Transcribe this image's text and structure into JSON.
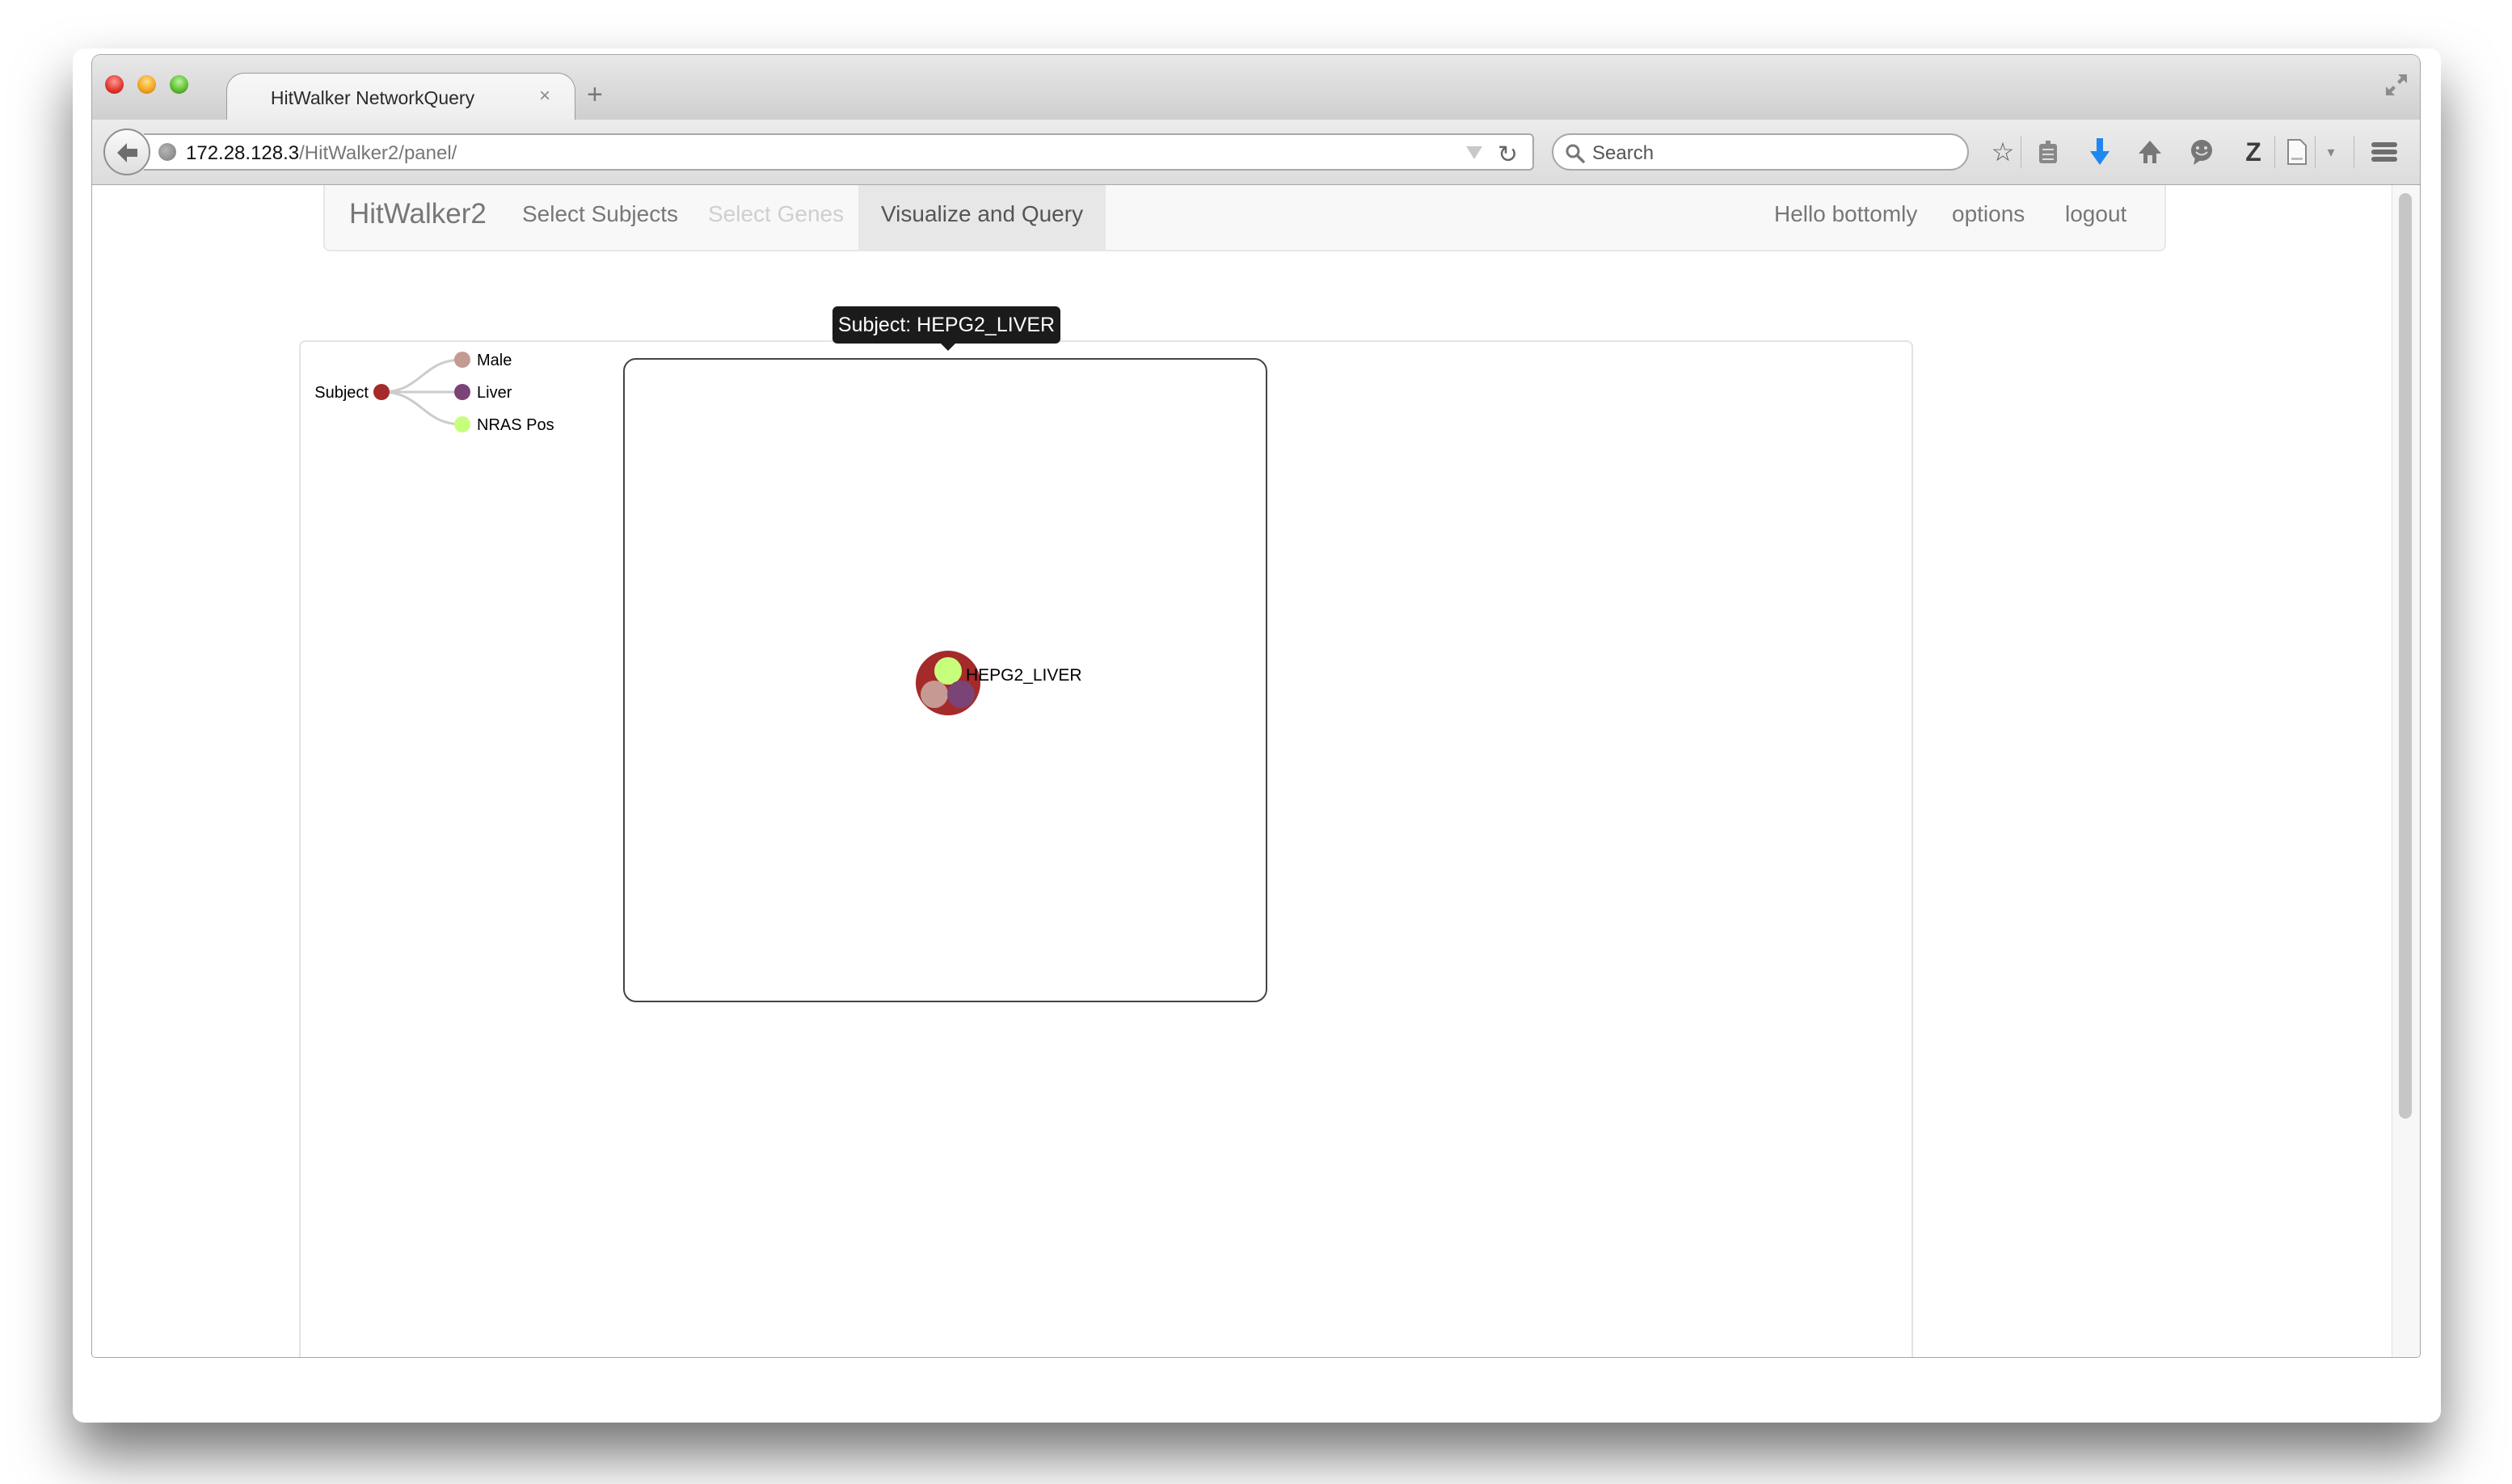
{
  "browser": {
    "tab_title": "HitWalker NetworkQuery",
    "tab_close": "×",
    "new_tab": "+",
    "url_host": "172.28.128.3",
    "url_path": "/HitWalker2/panel/",
    "search_placeholder": "Search",
    "reload_glyph": "↻",
    "toolbar_icons": [
      "bookmark-star-icon",
      "reading-list-icon",
      "downloads-icon",
      "home-icon",
      "chat-icon",
      "zotero-icon",
      "page-icon",
      "menu-icon"
    ]
  },
  "nav": {
    "brand": "HitWalker2",
    "items": [
      {
        "label": "Select Subjects",
        "state": "normal"
      },
      {
        "label": "Select Genes",
        "state": "disabled"
      },
      {
        "label": "Visualize and Query",
        "state": "active"
      }
    ],
    "right_items": [
      {
        "label": "Hello bottomly"
      },
      {
        "label": "options"
      },
      {
        "label": "logout"
      }
    ]
  },
  "legend": {
    "root": {
      "label": "Subject",
      "color": "#a52a2a"
    },
    "children": [
      {
        "label": "Male",
        "color": "#c49a93"
      },
      {
        "label": "Liver",
        "color": "#7a4476"
      },
      {
        "label": "NRAS Pos",
        "color": "#c6ff7c"
      }
    ]
  },
  "network": {
    "tooltip": "Subject: HEPG2_LIVER",
    "node": {
      "label": "HEPG2_LIVER",
      "color": "#a52a2a",
      "attributes": [
        {
          "name": "NRAS Pos",
          "color": "#c6ff7c"
        },
        {
          "name": "Male",
          "color": "#c49a93"
        },
        {
          "name": "Liver",
          "color": "#7a4476"
        }
      ]
    }
  }
}
